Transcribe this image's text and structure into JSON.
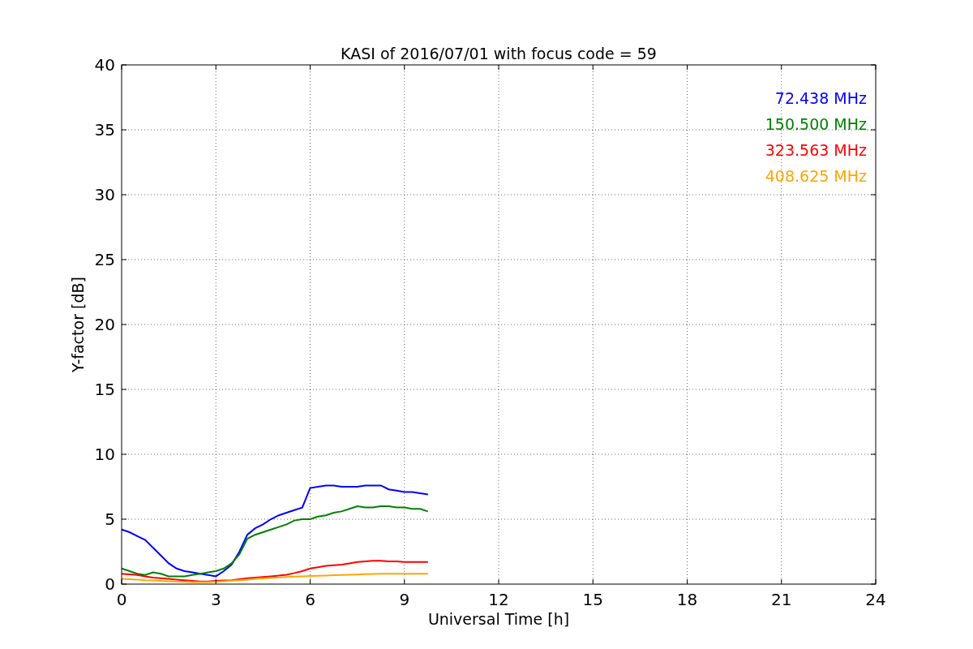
{
  "figure": {
    "chart_data": {
      "type": "line",
      "title": "KASI of 2016/07/01 with focus code = 59",
      "xlabel": "Universal Time [h]",
      "ylabel": "Y-factor [dB]",
      "x": [
        0,
        0.25,
        0.5,
        0.75,
        1,
        1.25,
        1.5,
        1.75,
        2,
        2.25,
        2.5,
        2.75,
        3,
        3.25,
        3.5,
        3.75,
        4,
        4.25,
        4.5,
        4.75,
        5,
        5.25,
        5.5,
        5.75,
        6,
        6.25,
        6.5,
        6.75,
        7,
        7.25,
        7.5,
        7.75,
        8,
        8.25,
        8.5,
        8.75,
        9,
        9.25,
        9.5,
        9.75
      ],
      "series": [
        {
          "name": "72.438 MHz",
          "color": "#0000ff",
          "values": [
            4.2,
            4.0,
            3.7,
            3.4,
            2.8,
            2.2,
            1.6,
            1.2,
            1.0,
            0.9,
            0.8,
            0.7,
            0.6,
            1.0,
            1.5,
            2.5,
            3.8,
            4.3,
            4.6,
            5.0,
            5.3,
            5.5,
            5.7,
            5.9,
            7.4,
            7.5,
            7.6,
            7.6,
            7.5,
            7.5,
            7.5,
            7.6,
            7.6,
            7.6,
            7.3,
            7.2,
            7.1,
            7.1,
            7.0,
            6.9
          ]
        },
        {
          "name": "150.500 MHz",
          "color": "#008000",
          "values": [
            1.2,
            1.0,
            0.8,
            0.7,
            0.9,
            0.8,
            0.6,
            0.6,
            0.6,
            0.7,
            0.8,
            0.9,
            1.0,
            1.2,
            1.6,
            2.3,
            3.5,
            3.8,
            4.0,
            4.2,
            4.4,
            4.6,
            4.9,
            5.0,
            5.0,
            5.2,
            5.3,
            5.5,
            5.6,
            5.8,
            6.0,
            5.9,
            5.9,
            6.0,
            6.0,
            5.9,
            5.9,
            5.8,
            5.8,
            5.6
          ]
        },
        {
          "name": "323.563 MHz",
          "color": "#ff0000",
          "values": [
            0.8,
            0.75,
            0.7,
            0.6,
            0.5,
            0.45,
            0.4,
            0.35,
            0.3,
            0.25,
            0.2,
            0.2,
            0.25,
            0.28,
            0.3,
            0.38,
            0.45,
            0.5,
            0.55,
            0.6,
            0.65,
            0.72,
            0.85,
            1.0,
            1.2,
            1.3,
            1.4,
            1.45,
            1.5,
            1.6,
            1.7,
            1.75,
            1.8,
            1.8,
            1.75,
            1.75,
            1.7,
            1.7,
            1.7,
            1.7
          ]
        },
        {
          "name": "408.625 MHz",
          "color": "#ffa500",
          "values": [
            0.4,
            0.38,
            0.35,
            0.3,
            0.28,
            0.25,
            0.22,
            0.2,
            0.18,
            0.16,
            0.15,
            0.15,
            0.18,
            0.22,
            0.26,
            0.3,
            0.35,
            0.4,
            0.44,
            0.48,
            0.52,
            0.55,
            0.58,
            0.6,
            0.62,
            0.64,
            0.66,
            0.68,
            0.7,
            0.72,
            0.74,
            0.76,
            0.78,
            0.8,
            0.8,
            0.8,
            0.8,
            0.8,
            0.8,
            0.8
          ]
        }
      ],
      "grid": true,
      "xlim": [
        0,
        24
      ],
      "ylim": [
        0,
        40
      ],
      "xticks": [
        0,
        3,
        6,
        9,
        12,
        15,
        18,
        21,
        24
      ],
      "yticks": [
        0,
        5,
        10,
        15,
        20,
        25,
        30,
        35,
        40
      ]
    }
  }
}
